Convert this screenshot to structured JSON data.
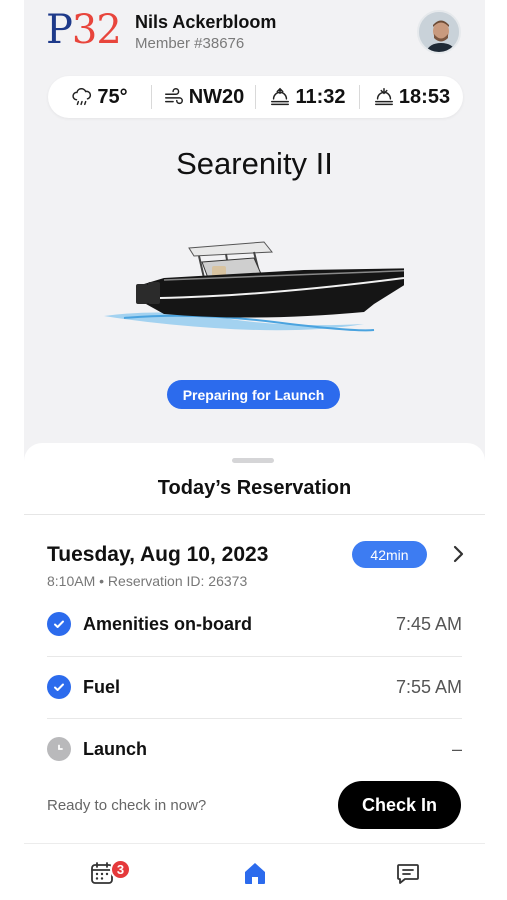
{
  "header": {
    "logo_p": "P",
    "logo_num": "32",
    "member_name": "Nils Ackerbloom",
    "member_id": "Member #38676"
  },
  "weather": [
    {
      "icon": "rain-cloud-icon",
      "value": "75°"
    },
    {
      "icon": "wind-icon",
      "value": "NW20"
    },
    {
      "icon": "sunrise-icon",
      "value": "11:32"
    },
    {
      "icon": "sunset-icon",
      "value": "18:53"
    }
  ],
  "boat": {
    "name": "Searenity II",
    "status": "Preparing for Launch"
  },
  "reservation": {
    "title": "Today’s Reservation",
    "date": "Tuesday, Aug 10, 2023",
    "subtitle": "8:10AM • Reservation ID: 26373",
    "countdown": "42min",
    "steps": [
      {
        "label": "Amenities on-board",
        "time": "7:45 AM",
        "done": true
      },
      {
        "label": "Fuel",
        "time": "7:55 AM",
        "done": true
      },
      {
        "label": "Launch",
        "time": "–",
        "done": false
      }
    ],
    "prompt": "Ready to check in now?",
    "checkin_label": "Check In"
  },
  "tabs": {
    "calendar_badge": "3",
    "active": "home"
  },
  "colors": {
    "accent": "#2c6bed",
    "badge_red": "#e5393b",
    "logo_blue": "#1e3a8a",
    "logo_red": "#e8453c"
  }
}
